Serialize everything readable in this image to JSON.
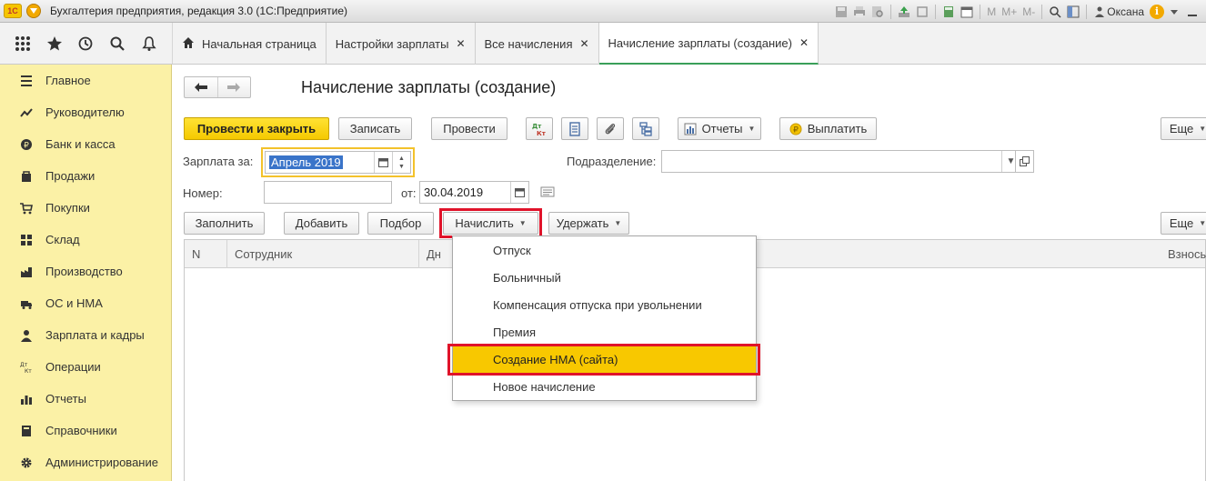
{
  "window": {
    "title": "Бухгалтерия предприятия, редакция 3.0  (1С:Предприятие)",
    "logo_text": "1С",
    "user": "Оксана",
    "memory_buttons": [
      "M",
      "M+",
      "M-"
    ]
  },
  "tabs": [
    {
      "label": "Начальная страница",
      "closable": false
    },
    {
      "label": "Настройки зарплаты",
      "closable": true
    },
    {
      "label": "Все начисления",
      "closable": true
    },
    {
      "label": "Начисление зарплаты (создание)",
      "closable": true,
      "active": true
    }
  ],
  "tab_close_glyph": "✕",
  "sidebar": {
    "items": [
      {
        "label": "Главное",
        "icon": "menu-lines-icon"
      },
      {
        "label": "Руководителю",
        "icon": "trend-icon"
      },
      {
        "label": "Банк и касса",
        "icon": "coin-icon"
      },
      {
        "label": "Продажи",
        "icon": "sales-icon"
      },
      {
        "label": "Покупки",
        "icon": "cart-icon"
      },
      {
        "label": "Склад",
        "icon": "warehouse-icon"
      },
      {
        "label": "Производство",
        "icon": "production-icon"
      },
      {
        "label": "ОС и НМА",
        "icon": "truck-icon"
      },
      {
        "label": "Зарплата и кадры",
        "icon": "person-icon"
      },
      {
        "label": "Операции",
        "icon": "dt-kt-icon"
      },
      {
        "label": "Отчеты",
        "icon": "bar-chart-icon"
      },
      {
        "label": "Справочники",
        "icon": "book-icon"
      },
      {
        "label": "Администрирование",
        "icon": "gear-icon"
      }
    ]
  },
  "form": {
    "title": "Начисление зарплаты (создание)",
    "toolbar": {
      "post_close": "Провести и закрыть",
      "save": "Записать",
      "post": "Провести",
      "dtkt": "Дт\nКт",
      "reports": "Отчеты",
      "pay": "Выплатить",
      "more": "Еще"
    },
    "fields": {
      "period_label": "Зарплата за:",
      "period_value": "Апрель 2019",
      "department_label": "Подразделение:",
      "department_value": "",
      "number_label": "Номер:",
      "number_value": "",
      "date_label": "от:",
      "date_value": "30.04.2019"
    },
    "table_toolbar": {
      "fill": "Заполнить",
      "add": "Добавить",
      "pick": "Подбор",
      "accrue": "Начислить",
      "withhold": "Удержать",
      "more": "Еще"
    },
    "table": {
      "columns": [
        "N",
        "Сотрудник",
        "Дн",
        "Взносы"
      ]
    }
  },
  "dropdown": {
    "items": [
      "Отпуск",
      "Больничный",
      "Компенсация отпуска при увольнении",
      "Премия",
      "Создание НМА (сайта)",
      "Новое начисление"
    ],
    "highlighted_index": 4
  },
  "colors": {
    "sidebar_bg": "#fbf1a6",
    "primary_button": "#f5c900",
    "highlight_item": "#f8c800",
    "annotation_red": "#e0132a",
    "active_tab_underline": "#3a9f59"
  }
}
